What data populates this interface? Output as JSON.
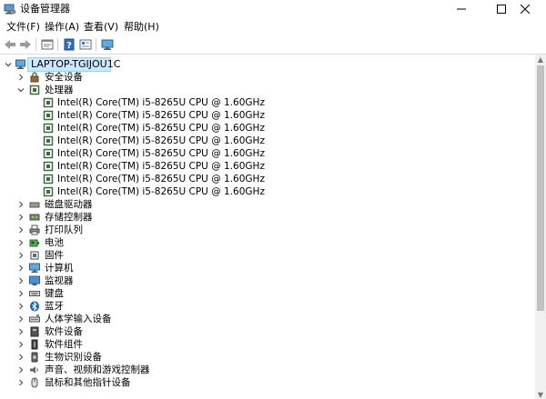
{
  "window": {
    "title": "设备管理器",
    "controls": {
      "minimize": "—",
      "maximize": "☐",
      "close": "✕"
    }
  },
  "menubar": {
    "items": [
      {
        "label": "文件(F)"
      },
      {
        "label": "操作(A)"
      },
      {
        "label": "查看(V)"
      },
      {
        "label": "帮助(H)"
      }
    ]
  },
  "toolbar": {
    "buttons": [
      "back-icon",
      "forward-icon",
      "properties-icon",
      "help-icon",
      "details-icon",
      "monitor-icon"
    ]
  },
  "tree": {
    "root": "LAPTOP-TGIJOU1C",
    "categories": [
      {
        "label": "安全设备",
        "icon": "security-device-icon",
        "expanded": false
      },
      {
        "label": "处理器",
        "icon": "processor-icon",
        "expanded": true,
        "children": [
          "Intel(R) Core(TM) i5-8265U CPU @ 1.60GHz",
          "Intel(R) Core(TM) i5-8265U CPU @ 1.60GHz",
          "Intel(R) Core(TM) i5-8265U CPU @ 1.60GHz",
          "Intel(R) Core(TM) i5-8265U CPU @ 1.60GHz",
          "Intel(R) Core(TM) i5-8265U CPU @ 1.60GHz",
          "Intel(R) Core(TM) i5-8265U CPU @ 1.60GHz",
          "Intel(R) Core(TM) i5-8265U CPU @ 1.60GHz",
          "Intel(R) Core(TM) i5-8265U CPU @ 1.60GHz"
        ]
      },
      {
        "label": "磁盘驱动器",
        "icon": "disk-drive-icon",
        "expanded": false
      },
      {
        "label": "存储控制器",
        "icon": "storage-controller-icon",
        "expanded": false
      },
      {
        "label": "打印队列",
        "icon": "printer-icon",
        "expanded": false
      },
      {
        "label": "电池",
        "icon": "battery-icon",
        "expanded": false
      },
      {
        "label": "固件",
        "icon": "firmware-icon",
        "expanded": false
      },
      {
        "label": "计算机",
        "icon": "computer-icon",
        "expanded": false
      },
      {
        "label": "监视器",
        "icon": "monitor-icon",
        "expanded": false
      },
      {
        "label": "键盘",
        "icon": "keyboard-icon",
        "expanded": false
      },
      {
        "label": "蓝牙",
        "icon": "bluetooth-icon",
        "expanded": false
      },
      {
        "label": "人体学输入设备",
        "icon": "hid-icon",
        "expanded": false
      },
      {
        "label": "软件设备",
        "icon": "software-device-icon",
        "expanded": false
      },
      {
        "label": "软件组件",
        "icon": "software-component-icon",
        "expanded": false
      },
      {
        "label": "生物识别设备",
        "icon": "biometric-icon",
        "expanded": false
      },
      {
        "label": "声音、视频和游戏控制器",
        "icon": "sound-icon",
        "expanded": false
      },
      {
        "label": "鼠标和其他指针设备",
        "icon": "mouse-icon",
        "expanded": false
      }
    ]
  },
  "colors": {
    "selection": "#cce8ff",
    "selection_border": "#99d1ff",
    "chip_green": "#3f6b3f",
    "bluetooth_blue": "#1565c0"
  }
}
